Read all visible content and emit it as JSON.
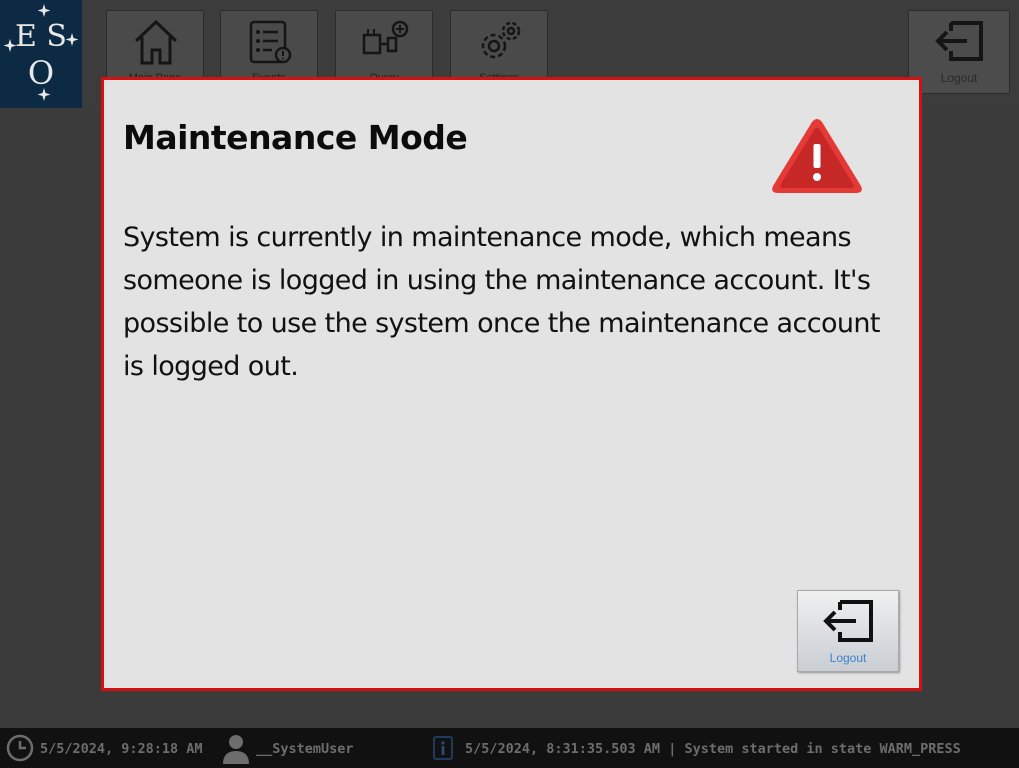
{
  "brand": {
    "logo_text": "ESO"
  },
  "nav": {
    "items": [
      {
        "label": "Main Page",
        "icon": "home-icon"
      },
      {
        "label": "Events",
        "icon": "event-list-icon"
      },
      {
        "label": "Overv",
        "icon": "overview-icon"
      },
      {
        "label": "Settings",
        "icon": "gear-icon"
      }
    ],
    "logout_label": "Logout"
  },
  "dialog": {
    "title": "Maintenance Mode",
    "icon": "warning-icon",
    "message": "System is currently in maintenance mode, which means someone is logged in using the maintenance account. It's possible to use the system once the maintenance account is logged out.",
    "logout_label": "Logout",
    "border_color": "#d41010",
    "logout_label_color": "#3a7fd0"
  },
  "status": {
    "time": "5/5/2024, 9:28:18 AM",
    "user": "__SystemUser",
    "message": "5/5/2024, 8:31:35.503 AM | System started in state WARM_PRESS"
  }
}
